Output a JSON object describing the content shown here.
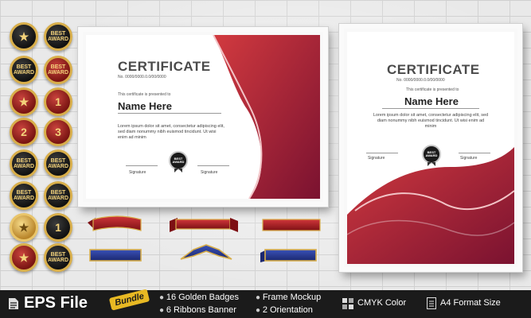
{
  "certificate": {
    "title": "CERTIFICATE",
    "number": "No. 0000/0000.0.0/00/0000",
    "presented": "This certificate is presented to",
    "name": "Name Here",
    "lorem": "Lorem ipsum dolor sit amet, consectetur adipiscing elit, sed diam nonummy nibh euismod tincidunt. Ut wisi enim ad minim",
    "signature": "Signature",
    "seal_top": "BEST",
    "seal_bottom": "AWARD"
  },
  "badges": {
    "best": "BEST",
    "award": "AWARD",
    "one": "1",
    "two": "2",
    "three": "3",
    "star": "★"
  },
  "footer": {
    "eps": "EPS File",
    "bundle": "Bundle",
    "f1": "16 Golden Badges",
    "f2": "6  Ribbons Banner",
    "f3": "Frame Mockup",
    "f4": "2 Orientation",
    "f5": "CMYK Color",
    "f6": "A4 Format Size"
  },
  "colors": {
    "accent_red": "#b3202b",
    "gold": "#d8ae4a",
    "bar": "#1b1b1b"
  }
}
